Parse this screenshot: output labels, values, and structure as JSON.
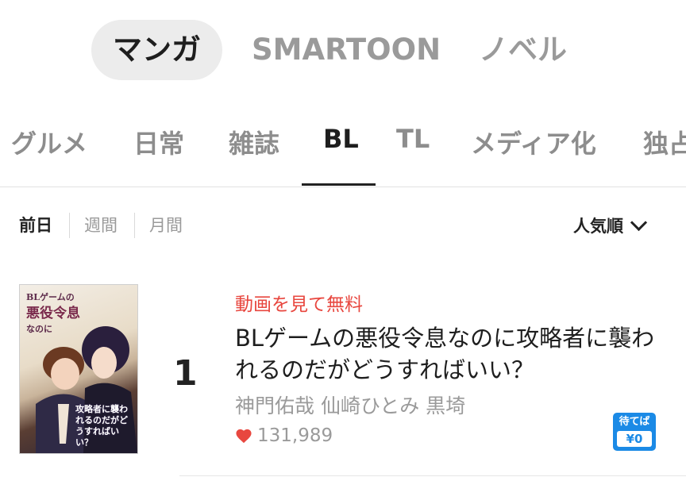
{
  "top_tabs": [
    {
      "label": "マンガ",
      "active": true
    },
    {
      "label": "SMARTOON",
      "active": false
    },
    {
      "label": "ノベル",
      "active": false
    }
  ],
  "genre_tabs": [
    {
      "label": "グルメ"
    },
    {
      "label": "日常"
    },
    {
      "label": "雑誌"
    },
    {
      "label": "BL",
      "active": true
    },
    {
      "label": "TL"
    },
    {
      "label": "メディア化"
    },
    {
      "label": "独占"
    }
  ],
  "period_tabs": [
    {
      "label": "前日",
      "active": true
    },
    {
      "label": "週間"
    },
    {
      "label": "月間"
    }
  ],
  "sort": {
    "label": "人気順",
    "icon": "chevron-down-icon"
  },
  "ranking": [
    {
      "rank": "1",
      "promo": "動画を見て無料",
      "title": "BLゲームの悪役令息なのに攻略者に襲われるのだがどうすればいい？",
      "authors": "神門佑哉 仙崎ひとみ 黒埼",
      "likes": "131,989",
      "badge": {
        "label": "待てば",
        "price": "¥0"
      },
      "cover": {
        "title_small": "BLゲームの",
        "title_big": "悪役令息",
        "title_tail": "なのに",
        "subtitle": "攻略者に襲われるのだがどうすればいい？"
      }
    }
  ],
  "colors": {
    "accent_red": "#e8473f",
    "badge_blue": "#1b8ae6",
    "active_text": "#1e1e1e",
    "inactive_text": "#9a9a9a"
  }
}
